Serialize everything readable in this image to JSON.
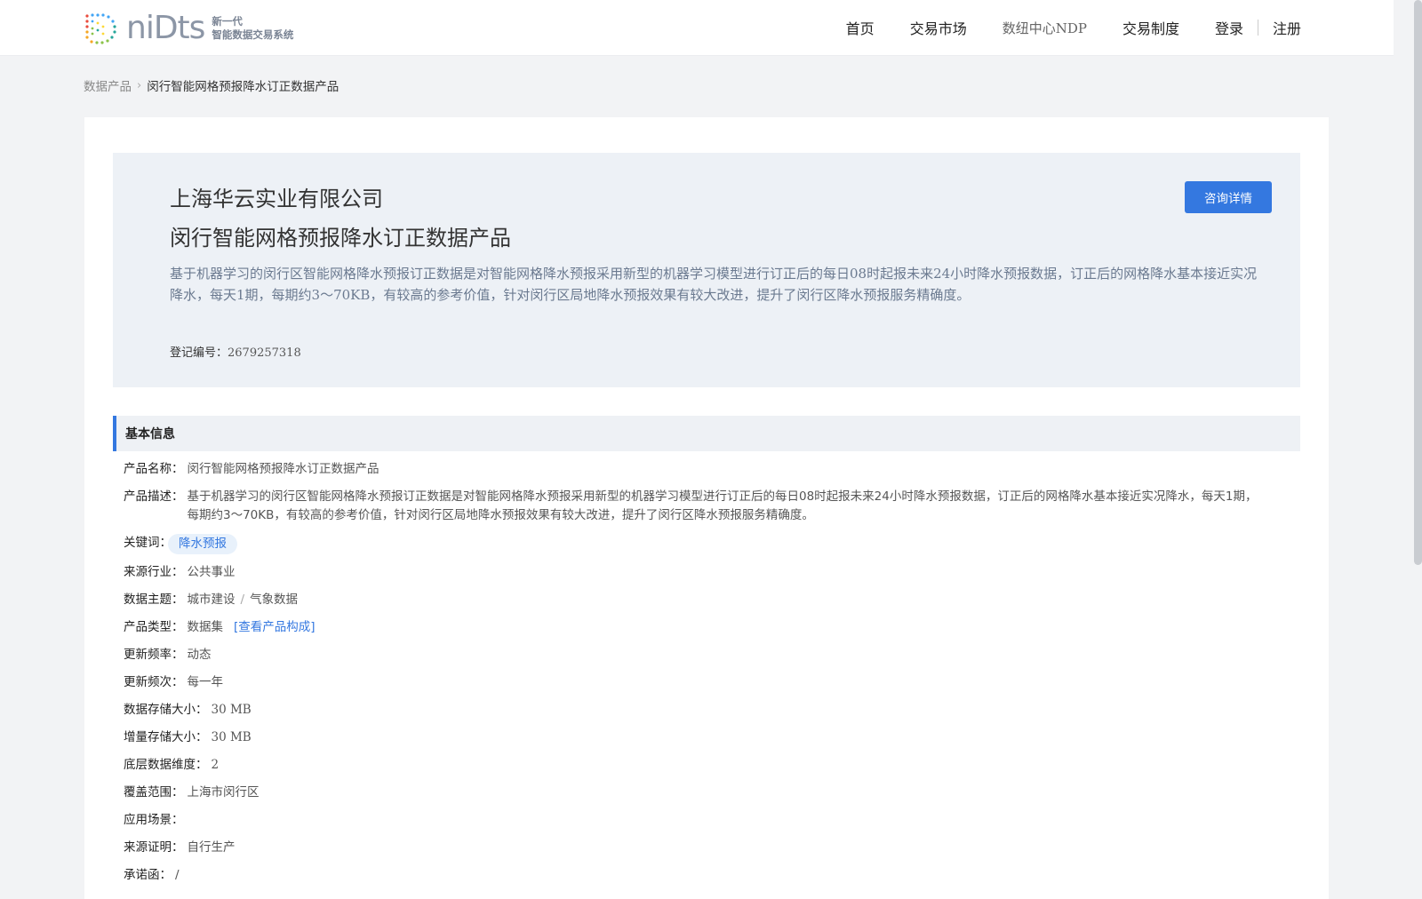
{
  "header": {
    "logo_word": "niDts",
    "logo_sub_line1": "新一代",
    "logo_sub_line2": "智能数据交易系统",
    "nav": [
      "首页",
      "交易市场",
      "数纽中心NDP",
      "交易制度"
    ],
    "login": "登录",
    "register": "注册"
  },
  "breadcrumb": {
    "root": "数据产品",
    "separator": "›",
    "current": "闵行智能网格预报降水订正数据产品"
  },
  "hero": {
    "company": "上海华云实业有限公司",
    "title": "闵行智能网格预报降水订正数据产品",
    "description": "基于机器学习的闵行区智能网格降水预报订正数据是对智能网格降水预报采用新型的机器学习模型进行订正后的每日08时起报未来24小时降水预报数据，订正后的网格降水基本接近实况降水，每天1期，每期约3～70KB，有较高的参考价值，针对闵行区局地降水预报效果有较大改进，提升了闵行区降水预报服务精确度。",
    "reg_label": "登记编号：",
    "reg_number": "2679257318",
    "consult_button": "咨询详情"
  },
  "basic_info": {
    "title": "基本信息",
    "product_name_label": "产品名称：",
    "product_name": "闵行智能网格预报降水订正数据产品",
    "product_desc_label": "产品描述：",
    "product_desc": "基于机器学习的闵行区智能网格降水预报订正数据是对智能网格降水预报采用新型的机器学习模型进行订正后的每日08时起报未来24小时降水预报数据，订正后的网格降水基本接近实况降水，每天1期，每期约3～70KB，有较高的参考价值，针对闵行区局地降水预报效果有较大改进，提升了闵行区降水预报服务精确度。",
    "keywords_label": "关键词：",
    "keyword": "降水预报",
    "industry_label": "来源行业：",
    "industry": "公共事业",
    "theme_label": "数据主题：",
    "theme_1": "城市建设",
    "theme_sep": "/",
    "theme_2": "气象数据",
    "type_label": "产品类型：",
    "type": "数据集",
    "type_link": "[查看产品构成]",
    "freq_label": "更新频率：",
    "freq": "动态",
    "times_label": "更新频次：",
    "times": "每一年",
    "storage_label": "数据存储大小：",
    "storage": "30 MB",
    "inc_storage_label": "增量存储大小：",
    "inc_storage": "30 MB",
    "dim_label": "底层数据维度：",
    "dim": "2",
    "coverage_label": "覆盖范围：",
    "coverage": "上海市闵行区",
    "scene_label": "应用场景：",
    "scene": "",
    "proof_label": "来源证明：",
    "proof": "自行生产",
    "commit_label": "承诺函：",
    "commit": "/"
  },
  "colors": {
    "accent": "#3478e0",
    "hero_bg": "#edf1f6",
    "page_bg": "#f2f3f5"
  }
}
